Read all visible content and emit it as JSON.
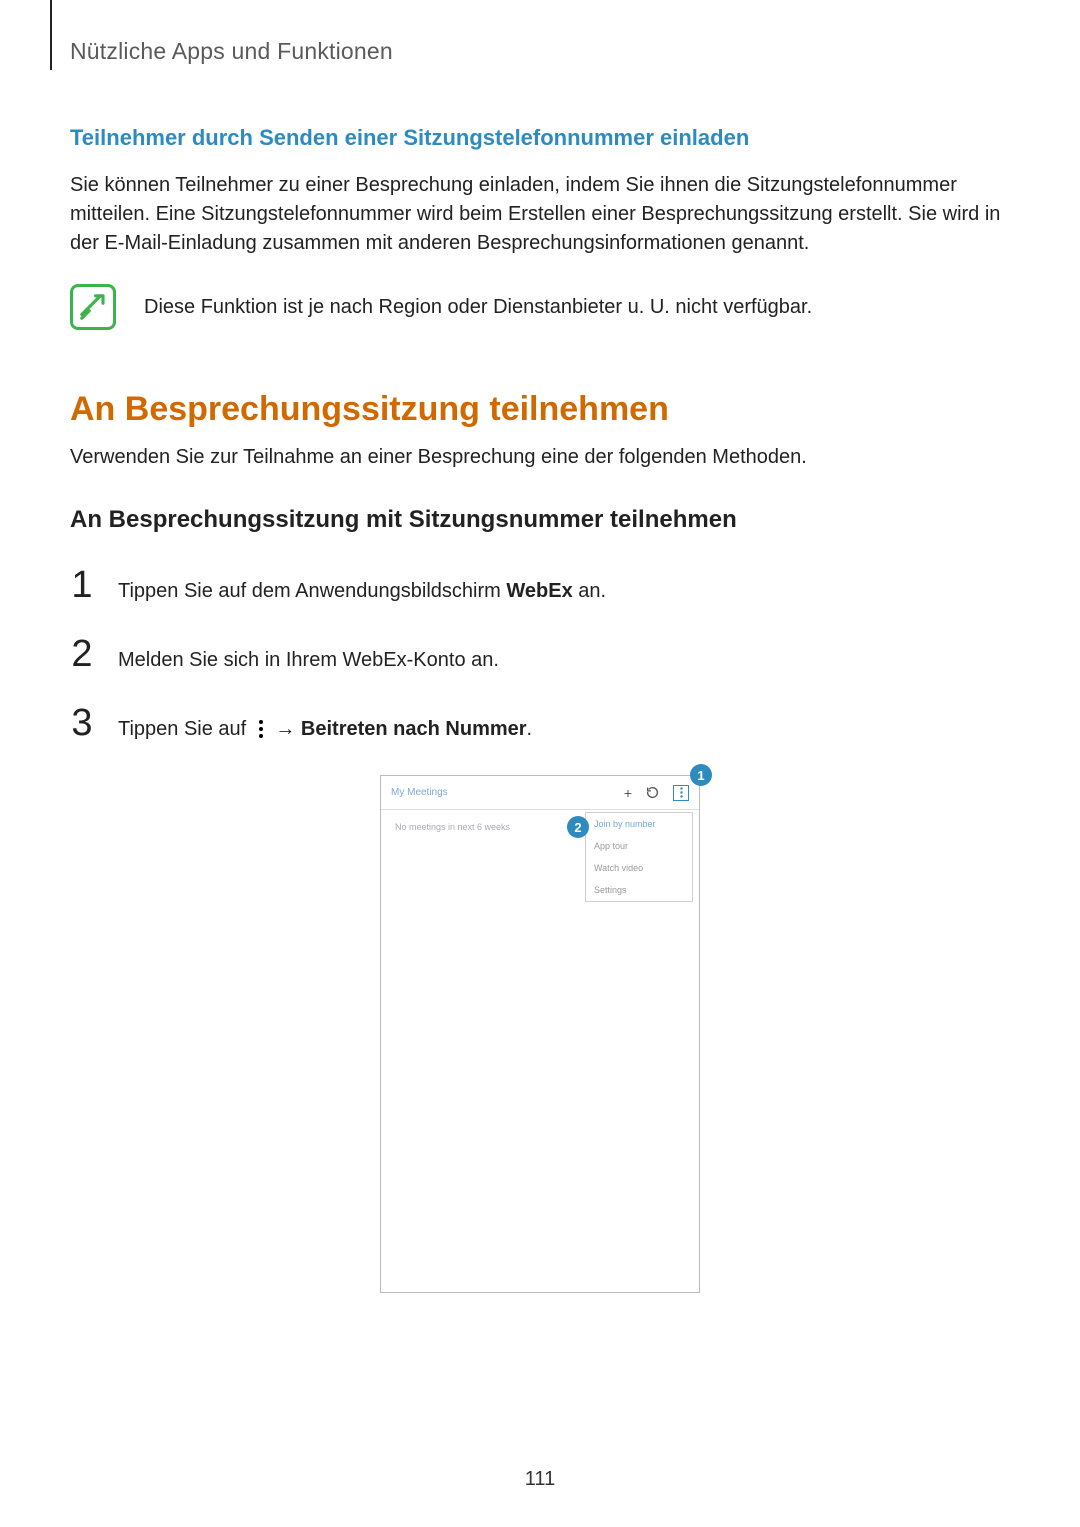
{
  "header": {
    "doc_section": "Nützliche Apps und Funktionen"
  },
  "s1": {
    "title": "Teilnehmer durch Senden einer Sitzungstelefonnummer einladen",
    "body": "Sie können Teilnehmer zu einer Besprechung einladen, indem Sie ihnen die Sitzungstelefonnummer mitteilen. Eine Sitzungstelefonnummer wird beim Erstellen einer Besprechungssitzung erstellt. Sie wird in der E-Mail-Einladung zusammen mit anderen Besprechungsinformationen genannt."
  },
  "note": {
    "text": "Diese Funktion ist je nach Region oder Dienstanbieter u. U. nicht verfügbar."
  },
  "h1": "An Besprechungssitzung teilnehmen",
  "h1_sub": "Verwenden Sie zur Teilnahme an einer Besprechung eine der folgenden Methoden.",
  "h2": "An Besprechungssitzung mit Sitzungsnummer teilnehmen",
  "steps": {
    "n1": "1",
    "t1a": "Tippen Sie auf dem Anwendungsbildschirm ",
    "t1b": "WebEx",
    "t1c": " an.",
    "n2": "2",
    "t2": "Melden Sie sich in Ihrem WebEx-Konto an.",
    "n3": "3",
    "t3a": "Tippen Sie auf ",
    "t3b": " → ",
    "t3c": "Beitreten nach Nummer",
    "t3d": "."
  },
  "device": {
    "header_title": "My Meetings",
    "plus": "+",
    "body_text": "No meetings in next 6 weeks",
    "menu": [
      "Join by number",
      "App tour",
      "Watch video",
      "Settings"
    ],
    "callout1": "1",
    "callout2": "2"
  },
  "page_number": "111"
}
